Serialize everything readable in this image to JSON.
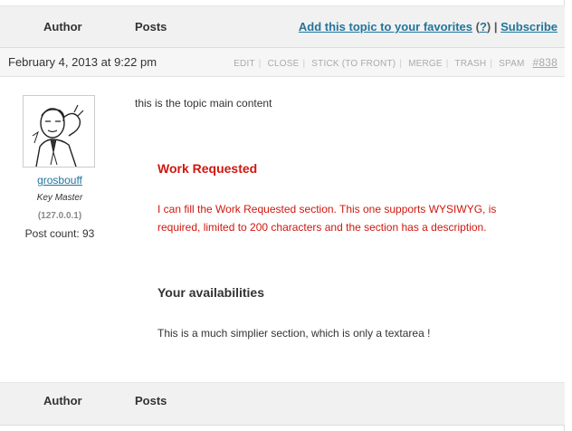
{
  "header": {
    "author_col": "Author",
    "posts_col": "Posts",
    "favorites_link": "Add this topic to your favorites",
    "favorites_help": "?",
    "separator": "|",
    "subscribe_link": "Subscribe"
  },
  "post": {
    "date": "February 4, 2013 at 9:22 pm",
    "actions": [
      "EDIT",
      "CLOSE",
      "STICK",
      "(TO FRONT)",
      "MERGE",
      "TRASH",
      "SPAM"
    ],
    "permalink": "#838",
    "content": "this is the topic main content"
  },
  "author": {
    "name": "grosbouff",
    "role": "Key Master",
    "ip": "(127.0.0.1)",
    "post_count": "Post count: 93"
  },
  "sections": {
    "work_title": "Work Requested",
    "work_desc": "I can fill the Work Requested section.  This one supports WYSIWYG, is required, limited to 200 characters and the section has a description.",
    "avail_title": "Your availabilities",
    "avail_desc": "This is a much simplier section, which is only a textarea !"
  },
  "footer": {
    "author_col": "Author",
    "posts_col": "Posts"
  },
  "colors": {
    "link": "#21759b",
    "required_red": "#d0170e",
    "header_bg": "#f1f1f1"
  }
}
